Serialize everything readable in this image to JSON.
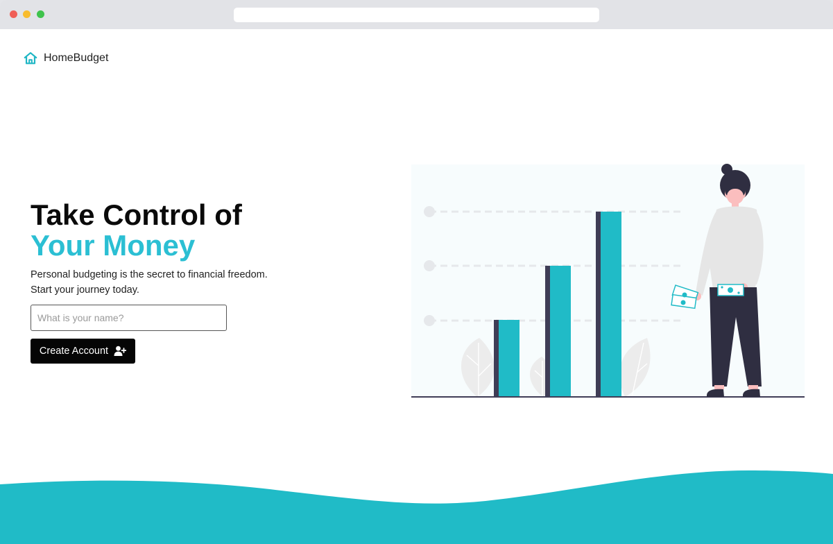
{
  "browser": {},
  "nav": {
    "brand_name": "HomeBudget",
    "brand_icon": "house-icon"
  },
  "hero": {
    "title_line1": "Take Control of",
    "title_line2": "Your Money",
    "subtitle_line1": "Personal budgeting is the secret to financial freedom.",
    "subtitle_line2": "Start your journey today."
  },
  "form": {
    "name_placeholder": "What is your name?",
    "name_value": "",
    "submit_label": "Create Account",
    "submit_icon": "user-plus-icon"
  },
  "colors": {
    "accent": "#2bbfd3",
    "teal_wave": "#20bbc7",
    "button_bg": "#050505",
    "bar_dark": "#3f3d56"
  }
}
